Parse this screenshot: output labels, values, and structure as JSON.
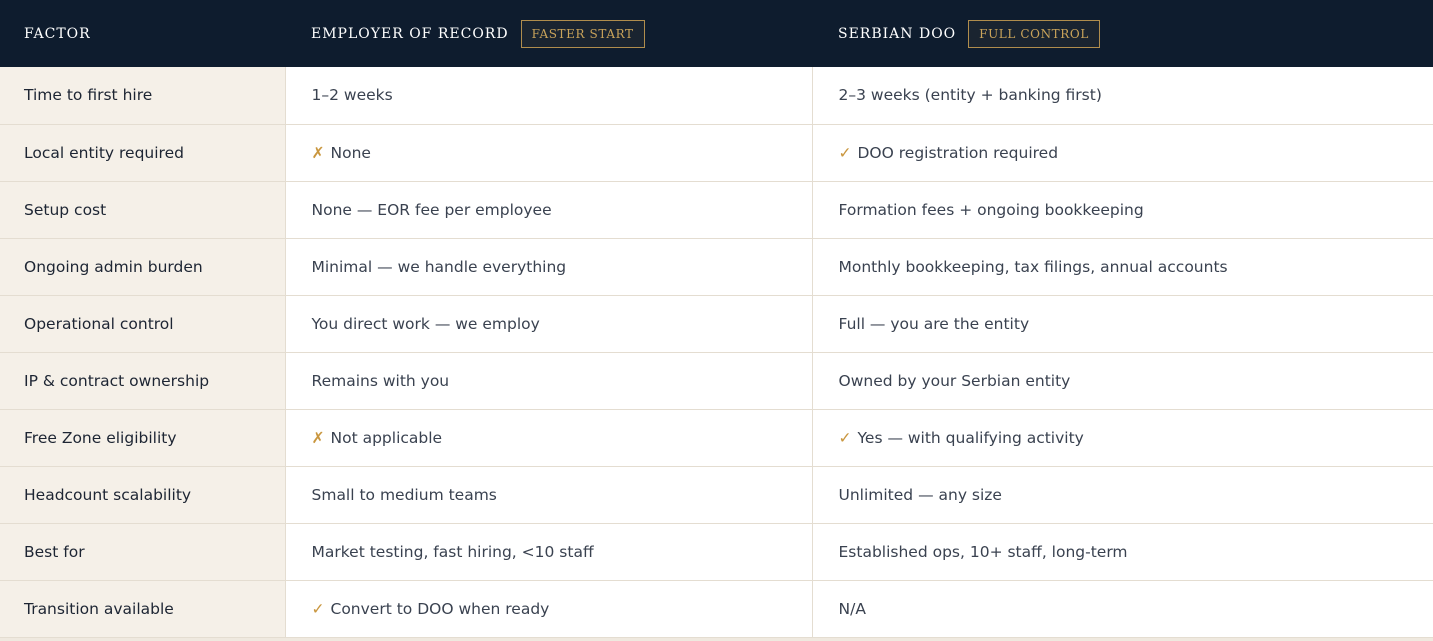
{
  "header": {
    "factor": "FACTOR",
    "eor": {
      "title": "EMPLOYER OF RECORD",
      "badge": "FASTER START"
    },
    "doo": {
      "title": "SERBIAN DOO",
      "badge": "FULL CONTROL"
    }
  },
  "icons": {
    "cross": "✗",
    "check": "✓"
  },
  "colors": {
    "header_bg": "#0e1c2e",
    "accent": "#c9963e",
    "factor_bg": "#f5f0e8"
  },
  "rows": [
    {
      "factor": "Time to first hire",
      "eor": "1–2 weeks",
      "doo": "2–3 weeks (entity + banking first)"
    },
    {
      "factor": "Local entity required",
      "eor": "None",
      "eor_icon": "cross",
      "doo": "DOO registration required",
      "doo_icon": "check"
    },
    {
      "factor": "Setup cost",
      "eor": "None — EOR fee per employee",
      "doo": "Formation fees + ongoing bookkeeping"
    },
    {
      "factor": "Ongoing admin burden",
      "eor": "Minimal — we handle everything",
      "doo": "Monthly bookkeeping, tax filings, annual accounts"
    },
    {
      "factor": "Operational control",
      "eor": "You direct work — we employ",
      "doo": "Full — you are the entity"
    },
    {
      "factor": "IP & contract ownership",
      "eor": "Remains with you",
      "doo": "Owned by your Serbian entity"
    },
    {
      "factor": "Free Zone eligibility",
      "eor": "Not applicable",
      "eor_icon": "cross",
      "doo": "Yes — with qualifying activity",
      "doo_icon": "check"
    },
    {
      "factor": "Headcount scalability",
      "eor": "Small to medium teams",
      "doo": "Unlimited — any size"
    },
    {
      "factor": "Best for",
      "eor": "Market testing, fast hiring, <10 staff",
      "doo": "Established ops, 10+ staff, long-term"
    },
    {
      "factor": "Transition available",
      "eor": "Convert to DOO when ready",
      "eor_icon": "check",
      "doo": "N/A"
    }
  ]
}
